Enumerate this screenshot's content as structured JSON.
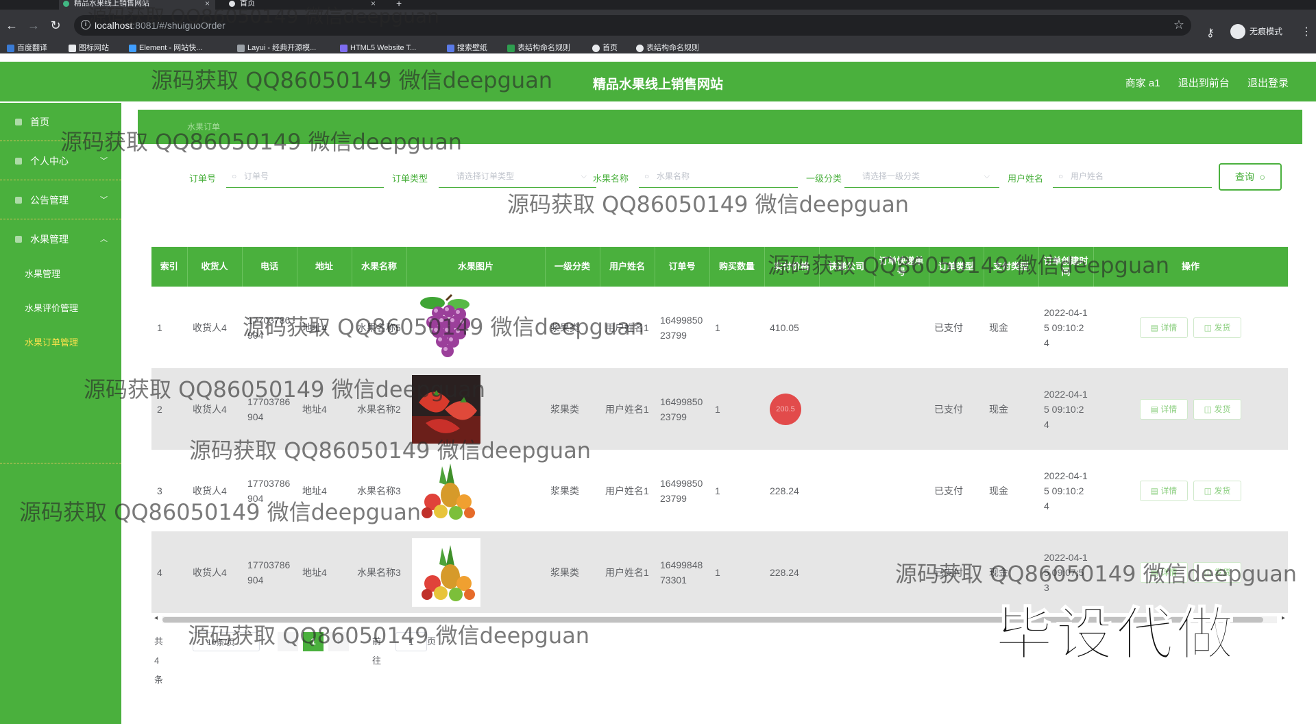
{
  "browser": {
    "tabs": [
      {
        "title": "精品水果线上销售网站",
        "active": true
      },
      {
        "title": "首页",
        "active": false
      }
    ],
    "url_host": "localhost",
    "url_rest": ":8081/#/shuiguoOrder",
    "incognito_label": "无痕模式",
    "bookmarks": [
      "百度翻译",
      "图标网站",
      "Element - 网站快...",
      "Layui - 经典开源模...",
      "HTML5 Website T...",
      "搜索壁纸",
      "表结构命名规则",
      "首页",
      "表结构命名规则"
    ]
  },
  "header": {
    "title": "精品水果线上销售网站",
    "user": "商家 a1",
    "to_front": "退出到前台",
    "logout": "退出登录"
  },
  "sidebar": {
    "items": [
      {
        "label": "首页"
      },
      {
        "label": "个人中心"
      },
      {
        "label": "公告管理"
      },
      {
        "label": "水果管理"
      }
    ],
    "subitems": [
      {
        "label": "水果管理"
      },
      {
        "label": "水果评价管理"
      },
      {
        "label": "水果订单管理"
      }
    ]
  },
  "breadcrumb": "水果订单",
  "search": {
    "order_no_label": "订单号",
    "order_no_placeholder": "订单号",
    "order_type_label": "订单类型",
    "order_type_placeholder": "请选择订单类型",
    "fruit_name_label": "水果名称",
    "fruit_name_placeholder": "水果名称",
    "category_label": "一级分类",
    "category_placeholder": "请选择一级分类",
    "username_label": "用户姓名",
    "username_placeholder": "用户姓名",
    "query_button": "查询"
  },
  "table": {
    "headers": [
      "索引",
      "收货人",
      "电话",
      "地址",
      "水果名称",
      "水果图片",
      "一级分类",
      "用户姓名",
      "订单号",
      "购买数量",
      "实付价格",
      "快递公司",
      "订单快递单号",
      "订单类型",
      "支付类型",
      "订单创建时间",
      "操作"
    ],
    "detail_label": "详情",
    "ship_label": "发货",
    "rows": [
      {
        "index": "1",
        "receiver": "收货人4",
        "phone": "17703786904",
        "address": "地址4",
        "fruit": "水果名称5",
        "image": "grape",
        "category": "浆果类",
        "username": "用户姓名1",
        "order_no": "1649985023799",
        "qty": "1",
        "price": "410.05",
        "express": "",
        "express_no": "",
        "type": "已支付",
        "pay": "现金",
        "time": "2022-04-15 09:10:24"
      },
      {
        "index": "2",
        "receiver": "收货人4",
        "phone": "17703786904",
        "address": "地址4",
        "fruit": "水果名称2",
        "image": "strawberry",
        "category": "浆果类",
        "username": "用户姓名1",
        "order_no": "1649985023799",
        "qty": "1",
        "price": "200.5",
        "express": "",
        "express_no": "",
        "type": "已支付",
        "pay": "现金",
        "time": "2022-04-15 09:10:24"
      },
      {
        "index": "3",
        "receiver": "收货人4",
        "phone": "17703786904",
        "address": "地址4",
        "fruit": "水果名称3",
        "image": "mixed",
        "category": "浆果类",
        "username": "用户姓名1",
        "order_no": "1649985023799",
        "qty": "1",
        "price": "228.24",
        "express": "",
        "express_no": "",
        "type": "已支付",
        "pay": "现金",
        "time": "2022-04-15 09:10:24"
      },
      {
        "index": "4",
        "receiver": "收货人4",
        "phone": "17703786904",
        "address": "地址4",
        "fruit": "水果名称3",
        "image": "mixed",
        "category": "浆果类",
        "username": "用户姓名1",
        "order_no": "1649984873301",
        "qty": "1",
        "price": "228.24",
        "express": "",
        "express_no": "",
        "type": "已支付",
        "pay": "现金",
        "time": "2022-04-15 09:07:53"
      }
    ]
  },
  "pagination": {
    "total": "共 4 条",
    "page_size": "10条/页",
    "current_page": "1",
    "goto_label": "前往",
    "goto_value": "1",
    "page_suffix": "页"
  },
  "watermark": {
    "text": "源码获取 QQ86050149 微信deepguan",
    "big_text": "毕设代做"
  },
  "colors": {
    "brand_green": "#4ab03d",
    "active_menu": "#ffe34d"
  }
}
